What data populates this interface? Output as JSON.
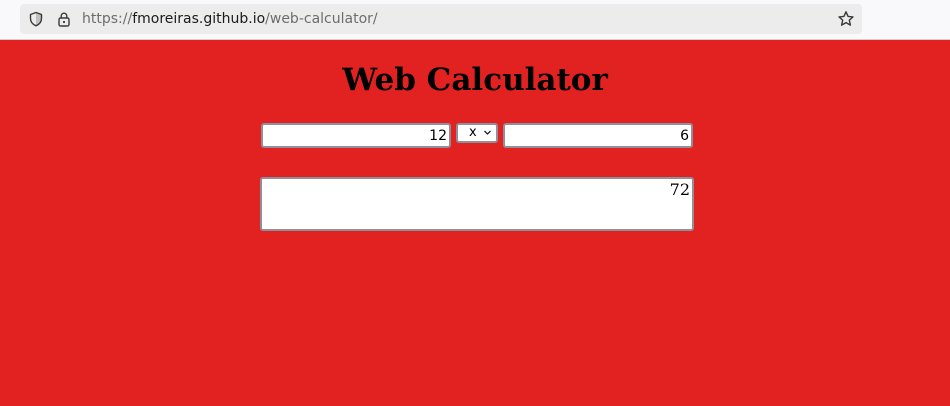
{
  "browser": {
    "url_scheme": "https://",
    "url_host": "fmoreiras.github.io",
    "url_path": "/web-calculator/"
  },
  "page": {
    "title": "Web Calculator"
  },
  "calculator": {
    "first_number": "12",
    "operator": "x",
    "second_number": "6",
    "result": "72"
  },
  "colors": {
    "page_background": "#e22221",
    "chrome_background": "#f9f9fb",
    "url_bar_background": "#ececec"
  },
  "icons": {
    "shield": "shield-icon",
    "lock": "lock-icon",
    "bookmark": "star-icon",
    "select_arrow": "chevron-down-icon"
  }
}
